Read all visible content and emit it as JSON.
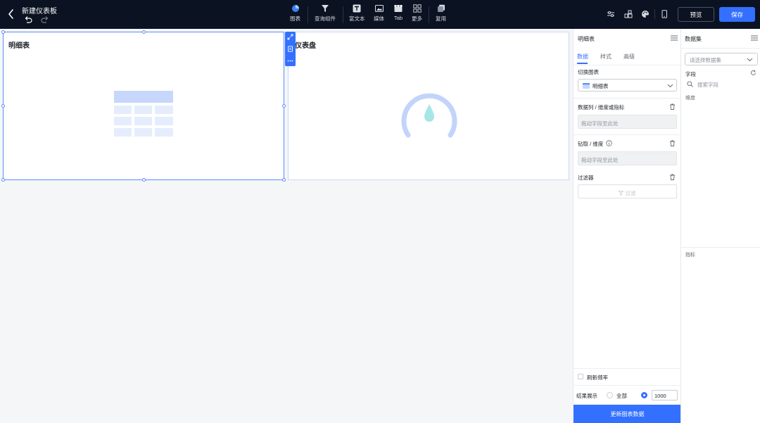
{
  "topbar": {
    "title": "新建仪表板",
    "tools": [
      {
        "icon": "chart-pie-icon",
        "label": "图表"
      },
      {
        "icon": "filter-funnel-icon",
        "label": "查询组件"
      },
      {
        "icon": "rich-text-icon",
        "label": "富文本"
      },
      {
        "icon": "image-media-icon",
        "label": "媒体"
      },
      {
        "icon": "tab-icon",
        "label": "Tab"
      },
      {
        "icon": "more-grid-icon",
        "label": "更多"
      },
      {
        "icon": "copy-reuse-icon",
        "label": "复用"
      }
    ],
    "preview_label": "预览",
    "save_label": "保存",
    "colors": {
      "bg": "#0b1221",
      "accent": "#3370ff"
    }
  },
  "canvas": {
    "cards": [
      {
        "title": "明细表",
        "icon": "table-placeholder-icon"
      },
      {
        "title": "仪表盘",
        "icon": "gauge-placeholder-icon"
      }
    ]
  },
  "config": {
    "title": "明细表",
    "tabs": [
      "数据",
      "样式",
      "高级"
    ],
    "switch_chart_label": "切换图表",
    "chart_type_value": "明细表",
    "columns_label": "数据列 / 维度或指标",
    "columns_placeholder": "拖动字段至此处",
    "drill_label": "钻取 / 维度",
    "drill_placeholder": "拖动字段至此处",
    "filter_label": "过滤器",
    "filter_button": "过滤",
    "refresh_label": "刷新频率",
    "result_label": "结果展示",
    "result_all": "全部",
    "result_count": "1000",
    "update_button": "更新图表数据"
  },
  "dataset": {
    "title": "数据集",
    "select_placeholder": "请选择数据集",
    "fields_label": "字段",
    "search_placeholder": "搜索字段",
    "dimension_label": "维度",
    "metric_label": "指标"
  }
}
